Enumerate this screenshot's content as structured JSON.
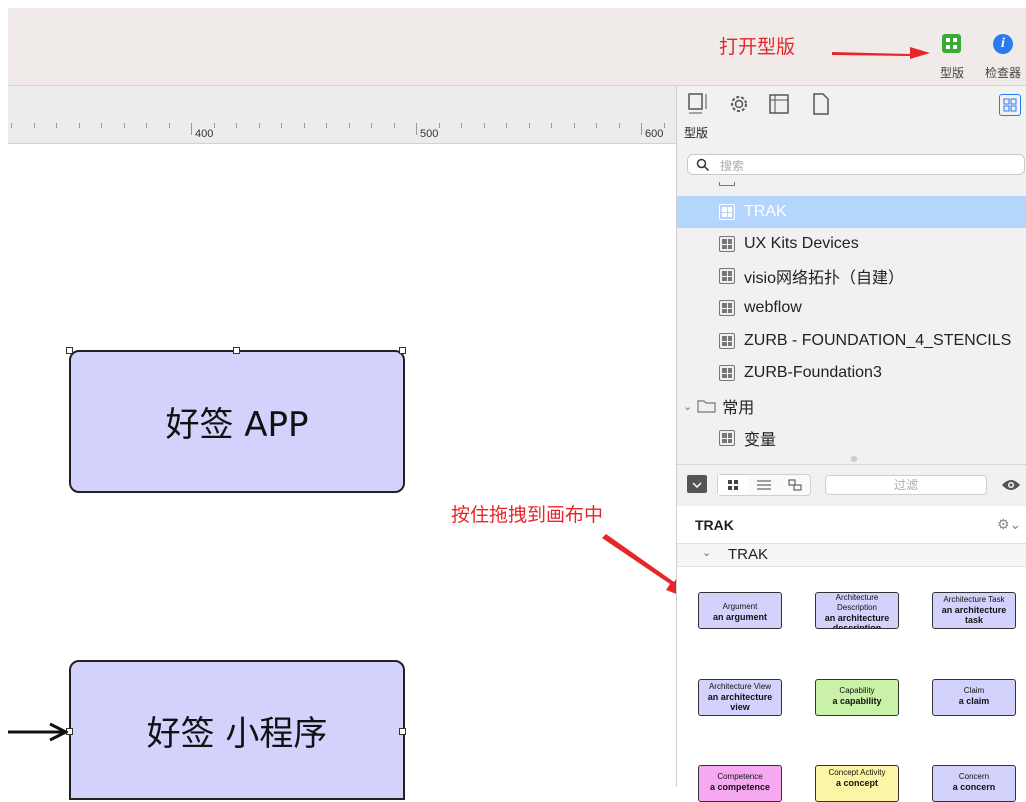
{
  "toolbar": {
    "annotation_open": "打开型版",
    "stencils_label": "型版",
    "inspector_label": "检查器"
  },
  "ruler": {
    "labels": [
      "400",
      "500",
      "600"
    ]
  },
  "canvas": {
    "shape1_label": "好签 APP",
    "shape2_label": "好签 小程序",
    "annotation_drag": "按住拖拽到画布中"
  },
  "panel": {
    "section_title": "型版",
    "search_placeholder": "搜索",
    "library": [
      {
        "label": "TRAK",
        "selected": true
      },
      {
        "label": "UX Kits Devices"
      },
      {
        "label": "visio网络拓扑（自建）"
      },
      {
        "label": "webflow"
      },
      {
        "label": "ZURB - FOUNDATION_4_STENCILS"
      },
      {
        "label": "ZURB-Foundation3"
      }
    ],
    "folder_label": "常用",
    "folder_item": "变量",
    "filter_placeholder": "过滤",
    "stencil_set_title": "TRAK",
    "group_title": "TRAK",
    "stencils": [
      {
        "line1": "Argument",
        "line2": "an argument"
      },
      {
        "line1": "Architecture Description",
        "line2": "an architecture description"
      },
      {
        "line1": "Architecture Task",
        "line2": "an architecture task"
      },
      {
        "line1": "Architecture View",
        "line2": "an architecture view"
      },
      {
        "line1": "Capability",
        "line2": "a capability"
      },
      {
        "line1": "Claim",
        "line2": "a claim"
      },
      {
        "line1": "Competence",
        "line2": "a competence"
      },
      {
        "line1": "Concept Activity",
        "line2": "a concept"
      },
      {
        "line1": "Concern",
        "line2": "a concern"
      }
    ]
  },
  "colors": {
    "annotation": "#e8262a",
    "shape_fill": "#d3d2fd",
    "selection": "#b4d6fd",
    "stencils_icon": "#3aa935",
    "inspector_icon": "#2b7bf0"
  }
}
